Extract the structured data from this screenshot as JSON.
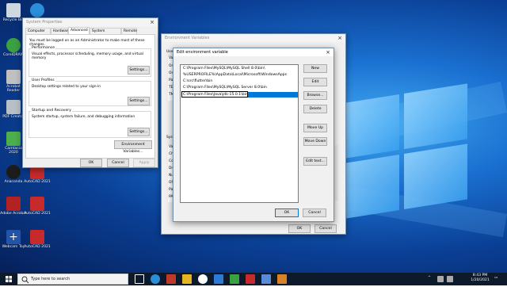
{
  "desktop_icons": [
    {
      "label": "Recycle Bin",
      "color": "#cfd8e0"
    },
    {
      "label": "Microsoft Edge",
      "color": "#2a8fd8"
    },
    {
      "label": "CorelDRAW",
      "color": "#3aa040"
    },
    {
      "label": "Acrobat Reader",
      "color": "#c0c0c0"
    },
    {
      "label": "PDF Creator",
      "color": "#b8bfc6"
    },
    {
      "label": "Camtasia 2020",
      "color": "#4cae4c"
    },
    {
      "label": "Anaconda",
      "color": "#1c1c1c"
    },
    {
      "label": "AutoCAD 2021",
      "color": "#c62a2a"
    },
    {
      "label": "Adobe Acrobat",
      "color": "#b22222"
    },
    {
      "label": "AutoCAD 2021",
      "color": "#c62a2a"
    },
    {
      "label": "Webcam Toy",
      "color": "#2255aa"
    },
    {
      "label": "AutoCAD 2021",
      "color": "#c62a2a"
    }
  ],
  "system_properties": {
    "title": "System Properties",
    "tabs": [
      "Computer Name",
      "Hardware",
      "Advanced",
      "System Protection",
      "Remote"
    ],
    "notice": "You must be logged on as an Administrator to make most of these changes.",
    "performance": {
      "label": "Performance",
      "text": "Visual effects, processor scheduling, memory usage, and virtual memory",
      "button": "Settings..."
    },
    "user_profiles": {
      "label": "User Profiles",
      "text": "Desktop settings related to your sign-in",
      "button": "Settings..."
    },
    "startup": {
      "label": "Startup and Recovery",
      "text": "System startup, system failure, and debugging information",
      "button": "Settings..."
    },
    "env_button": "Environment Variables...",
    "ok": "OK",
    "cancel": "Cancel",
    "apply": "Apply"
  },
  "environment_variables": {
    "title": "Environment Variables",
    "user_section_initial": "Use",
    "user_var_initials": [
      "Va",
      "On",
      "On",
      "Pa",
      "TE",
      "TM"
    ],
    "system_section_initial": "Syst",
    "system_var_initials": [
      "Va",
      "Ch",
      "Co",
      "Dr",
      "Nu",
      "OS",
      "Pa",
      "PA"
    ],
    "ok": "OK",
    "cancel": "Cancel"
  },
  "edit_env": {
    "title": "Edit environment variable",
    "entries": [
      "C:\\Program Files\\MySQL\\MySQL Shell 8.0\\bin\\",
      "%USERPROFILE%\\AppData\\Local\\Microsoft\\WindowsApps",
      "C:\\src\\flutter\\bin",
      "C:\\Program Files\\MySQL\\MySQL Server 8.0\\bin",
      "C:\\Program Files\\Java\\jdk-15.0.1\\bin"
    ],
    "editing_index": 4,
    "buttons": {
      "new": "New",
      "edit": "Edit",
      "browse": "Browse...",
      "delete": "Delete",
      "move_up": "Move Up",
      "move_down": "Move Down",
      "edit_text": "Edit text...",
      "ok": "OK",
      "cancel": "Cancel"
    }
  },
  "taskbar": {
    "search_placeholder": "Type here to search",
    "time": "8:43 PM",
    "date": "1/20/2021"
  },
  "colors": {
    "accent": "#0078d7",
    "taskbar": "#0d1a2b"
  }
}
